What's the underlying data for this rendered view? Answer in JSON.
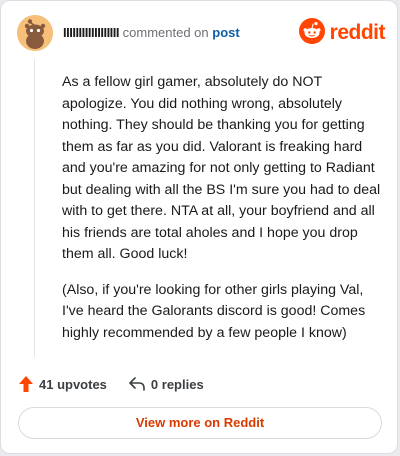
{
  "header": {
    "username": "IIIIIIIIIIIIIIIIII",
    "commented_on": "commented on",
    "post_link": "post",
    "brand": "reddit"
  },
  "comment": {
    "paragraphs": [
      "As a fellow girl gamer, absolutely do NOT apologize. You did nothing wrong, absolutely nothing. They should be thanking you for getting them as far as you did. Valorant is freaking hard and you're amazing for not only getting to Radiant but dealing with all the BS I'm sure you had to deal with to get there. NTA at all, your boyfriend and all his friends are total aholes and I hope you drop them all. Good luck!",
      "(Also, if you're looking for other girls playing Val, I've heard the Galorants discord is good! Comes highly recommended by a few people I know)"
    ]
  },
  "actions": {
    "upvotes": "41 upvotes",
    "replies": "0 replies"
  },
  "footer": {
    "view_more": "View more on Reddit"
  },
  "colors": {
    "brand": "#ff4500",
    "link": "#0f5ea8",
    "view_more": "#d93a00"
  },
  "icons": {
    "avatar": "snoo-avatar-icon",
    "brand": "reddit-logo-icon",
    "upvote": "upvote-arrow-icon",
    "reply": "reply-arrow-icon"
  }
}
